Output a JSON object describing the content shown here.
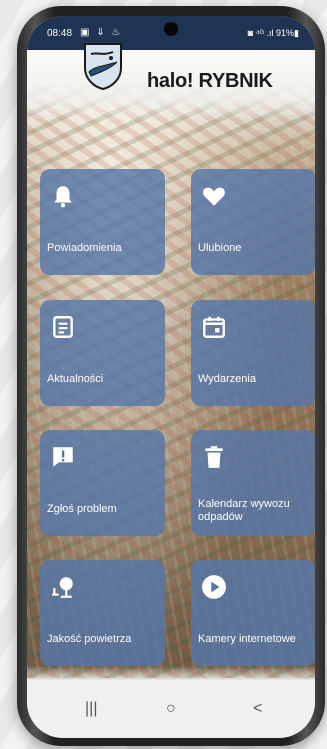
{
  "status_bar": {
    "time": "08:48",
    "left_icons": "▣ ⇓ ♨",
    "right_text": "◙ ⁴ᴳ .ıl 91%▮"
  },
  "app": {
    "name_halo": "halo!",
    "name_city": "RYBNIK"
  },
  "tiles": [
    {
      "label": "Powiadomienia",
      "icon": "bell-icon"
    },
    {
      "label": "Ulubione",
      "icon": "heart-icon"
    },
    {
      "label": "Aktualności",
      "icon": "news-icon"
    },
    {
      "label": "Wydarzenia",
      "icon": "calendar-icon"
    },
    {
      "label": "Zgłoś problem",
      "icon": "report-icon"
    },
    {
      "label": "Kalendarz wywozu odpadów",
      "icon": "trash-icon"
    },
    {
      "label": "Jakość powietrza",
      "icon": "air-quality-icon"
    },
    {
      "label": "Kamery internetowe",
      "icon": "play-icon"
    }
  ],
  "nav": {
    "recents": "|||",
    "home": "○",
    "back": "<"
  },
  "colors": {
    "tile": "#5676a8",
    "status_bar": "#1f3452"
  }
}
